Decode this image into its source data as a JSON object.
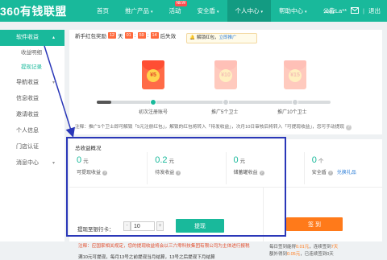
{
  "topbar": {
    "logo": "360有钱联盟",
    "nav": [
      {
        "label": "首页"
      },
      {
        "label": "推广产品",
        "caret": "▾"
      },
      {
        "label": "活动",
        "badge": "NEW"
      },
      {
        "label": "安全盾",
        "caret": "▾"
      },
      {
        "label": "个人中心",
        "caret": "▾"
      },
      {
        "label": "帮助中心",
        "caret": "▾"
      },
      {
        "label": "公告"
      }
    ],
    "username": "nazLa**",
    "separator": "|",
    "logout": "退出"
  },
  "sidebar": {
    "items": [
      {
        "label": "软件收益",
        "type": "parent",
        "chev": "▴"
      },
      {
        "label": "收益明细",
        "type": "sub"
      },
      {
        "label": "提现记录",
        "type": "sub"
      },
      {
        "label": "导航收益",
        "type": "parent",
        "chev": "▾"
      },
      {
        "label": "信息收益",
        "type": "parent"
      },
      {
        "label": "邀请收益",
        "type": "parent"
      },
      {
        "label": "个人信息",
        "type": "parent"
      },
      {
        "label": "门店认证",
        "type": "parent"
      },
      {
        "label": "消息中心",
        "type": "parent",
        "chev": "▾"
      }
    ]
  },
  "reward": {
    "title": "新手红包奖励",
    "countdown": [
      "12",
      "天",
      "01",
      ":",
      "59",
      ":",
      "14",
      "后失效"
    ],
    "tip_text": "解锁红包，",
    "tip_link": "立即推广",
    "envelopes": [
      "¥5",
      "¥10",
      "¥15"
    ],
    "steps": [
      "初次注册账号",
      "推广5个卫士",
      "推广10个卫士"
    ],
    "note": "注释：推广5个卫士即可解锁「5元注册红包」，解锁的红包将转入「待发收益」，次月10日审核后将转入「可提现收益」，您可手动提现",
    "note_help": "?"
  },
  "overview": {
    "title": "总收益概况",
    "stats": [
      {
        "value": "0",
        "unit": "元",
        "label": "可提现收益",
        "help": "?"
      },
      {
        "value": "0.2",
        "unit": "元",
        "label": "待发收益",
        "help": "?"
      },
      {
        "value": "0",
        "unit": "元",
        "label": "储蓄罐收益",
        "help": "?"
      },
      {
        "value": "0",
        "unit": "个",
        "label": "安全盾",
        "help": "?",
        "link": "兑换礼品"
      }
    ]
  },
  "withdraw": {
    "label": "提现至银行卡：",
    "minus": "-",
    "plus": "+",
    "amount": "10",
    "button": "提现",
    "warning": "注释：应国家相关规定，您的提现收益将会以三六零科技集团有限公司为主体进行报税",
    "rule": "满10元可提现，每月13号之前提现当月结算，13号之后提现下月结算"
  },
  "checkin": {
    "button": "签 到",
    "line1_pre": "每日签到能得",
    "line1_val": "0.01元",
    "line1_mid": "，连续签到",
    "line1_days": "7天",
    "line2_pre": "额外得到",
    "line2_val": "0.05元",
    "line2_post": "，已连续签到0天"
  },
  "colors": {
    "brand": "#19b99b",
    "highlight_box": "#2a37b8",
    "checkin_orange": "#ff7a1a",
    "warning_red": "#e24c2b"
  }
}
